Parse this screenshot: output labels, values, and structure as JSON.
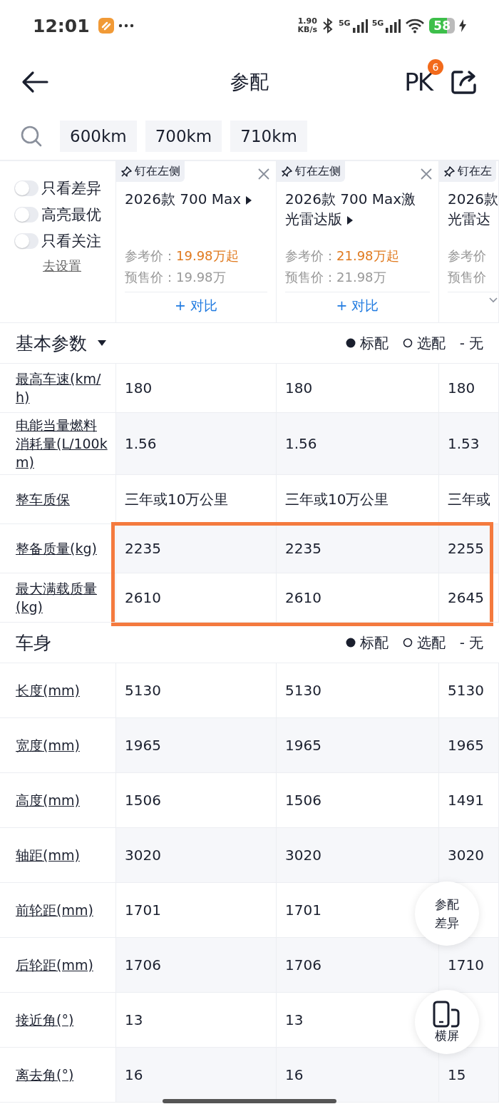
{
  "status_bar": {
    "time": "12:01",
    "speed": "1.90",
    "speed_unit": "KB/s",
    "networks": [
      "5G",
      "5G"
    ],
    "battery": "58"
  },
  "nav": {
    "title": "参配",
    "pk": "PK",
    "pk_badge": "6"
  },
  "chips": [
    {
      "label": "600km"
    },
    {
      "label": "700km"
    },
    {
      "label": "710km"
    }
  ],
  "filters": [
    {
      "label": "只看差异",
      "on": false
    },
    {
      "label": "高亮最优",
      "on": false
    },
    {
      "label": "只看关注",
      "on": false
    }
  ],
  "settings_link": "去设置",
  "cars": [
    {
      "pin": "钉在左侧",
      "title": "2026款 700 Max",
      "ref_label": "参考价：",
      "ref_price": "19.98万起",
      "pre_label": "预售价：",
      "pre_price": "19.98万",
      "compare": "+ 对比"
    },
    {
      "pin": "钉在左侧",
      "title": "2026款 700 Max激光雷达版",
      "ref_label": "参考价：",
      "ref_price": "21.98万起",
      "pre_label": "预售价：",
      "pre_price": "21.98万",
      "compare": "+ 对比"
    },
    {
      "pin": "钉在左",
      "title": "2026款",
      "title_2": "光雷达",
      "ref_label": "参考价",
      "pre_label": "预售价"
    }
  ],
  "sections": [
    {
      "title": "基本参数",
      "dropdown": true,
      "legend": [
        {
          "kind": "standard",
          "label": "标配"
        },
        {
          "kind": "optional",
          "label": "选配"
        },
        {
          "kind": "none",
          "symbol": "-",
          "label": "无"
        }
      ],
      "rows": [
        {
          "label": "最高车速(km/h)",
          "values": [
            "180",
            "180",
            "180"
          ]
        },
        {
          "label": "电能当量燃料消耗量(L/100km)",
          "values": [
            "1.56",
            "1.56",
            "1.53"
          ]
        },
        {
          "label": "整车质保",
          "values": [
            "三年或10万公里",
            "三年或10万公里",
            "三年或"
          ]
        },
        {
          "label": "整备质量(kg)",
          "values": [
            "2235",
            "2235",
            "2255"
          ],
          "highlighted": true
        },
        {
          "label": "最大满载质量(kg)",
          "values": [
            "2610",
            "2610",
            "2645"
          ],
          "highlighted": true
        }
      ]
    },
    {
      "title": "车身",
      "legend": [
        {
          "kind": "standard",
          "label": "标配"
        },
        {
          "kind": "optional",
          "label": "选配"
        },
        {
          "kind": "none",
          "symbol": "-",
          "label": "无"
        }
      ],
      "rows": [
        {
          "label": "长度(mm)",
          "values": [
            "5130",
            "5130",
            "5130"
          ]
        },
        {
          "label": "宽度(mm)",
          "values": [
            "1965",
            "1965",
            "1965"
          ]
        },
        {
          "label": "高度(mm)",
          "values": [
            "1506",
            "1506",
            "1491"
          ]
        },
        {
          "label": "轴距(mm)",
          "values": [
            "3020",
            "3020",
            "3020"
          ]
        },
        {
          "label": "前轮距(mm)",
          "values": [
            "1701",
            "1701"
          ]
        },
        {
          "label": "后轮距(mm)",
          "values": [
            "1706",
            "1706",
            "1710"
          ]
        },
        {
          "label": "接近角(°)",
          "values": [
            "13",
            "13"
          ]
        },
        {
          "label": "离去角(°)",
          "values": [
            "16",
            "16",
            "15"
          ]
        }
      ]
    }
  ],
  "floating": [
    {
      "kind": "diff",
      "label": "参配差异"
    },
    {
      "kind": "rotate",
      "label": "横屏"
    }
  ]
}
